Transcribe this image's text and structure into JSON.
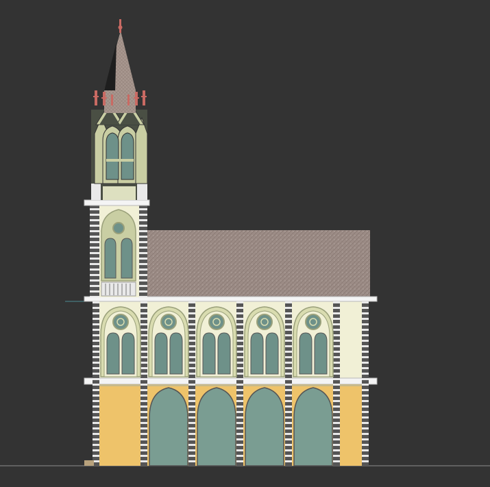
{
  "scene": {
    "subject": "church-elevation",
    "colors": {
      "background": "#333333",
      "roof": "#9c8c86",
      "roof_dark": "#7d6e69",
      "upper_wall": "#f1f0d6",
      "lower_wall": "#eec36a",
      "lower_wall_dark": "#d8a84e",
      "pilaster": "#555555",
      "pilaster_light": "#e9e9e9",
      "cornice": "#f4f4f4",
      "cornice_shadow": "#b9b9b9",
      "window_glass": "#6e9189",
      "window_frame": "#d9dcb0",
      "window_frame_dark": "#9aa07a",
      "arch_door": "#7a9d92",
      "tower_green": "#c9cea3",
      "tower_dark": "#4a4f44",
      "spire": "#a99890",
      "finial": "#c96a63",
      "ground": "#8c8c8c"
    },
    "bays": {
      "upper": 5,
      "lower": 4
    },
    "tower": {
      "present": true,
      "spire_finials": 6
    }
  }
}
